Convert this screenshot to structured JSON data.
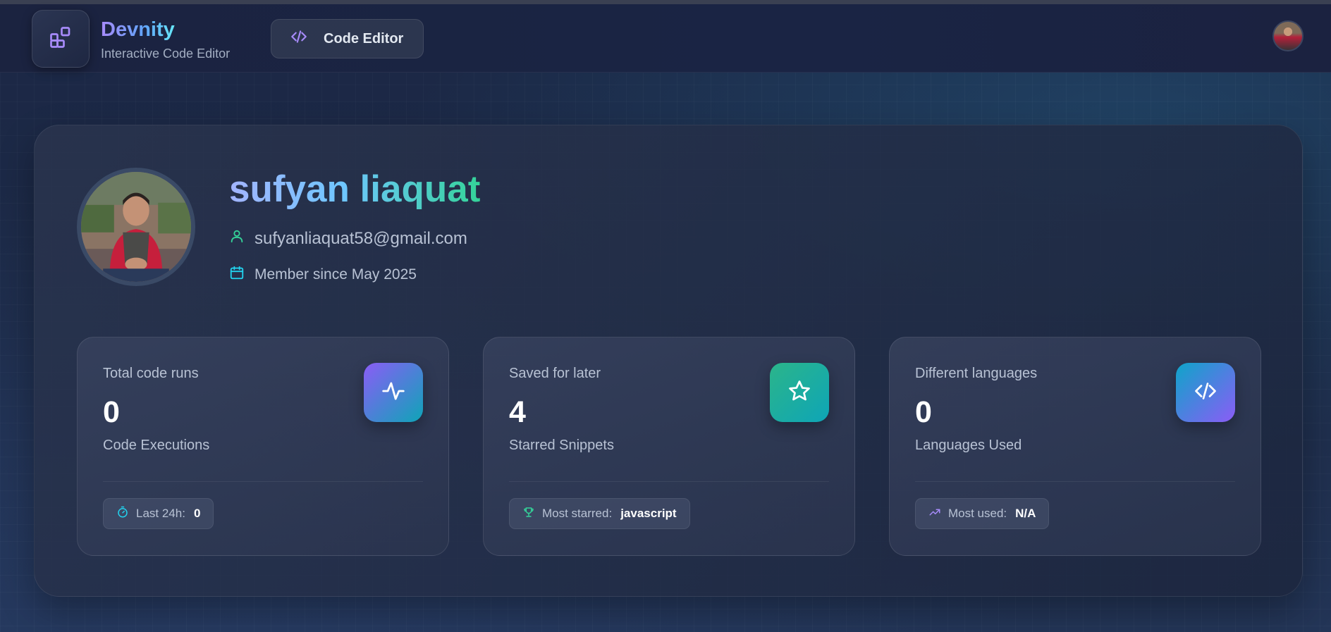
{
  "brand": {
    "title": "Devnity",
    "subtitle": "Interactive Code Editor"
  },
  "nav": {
    "code_editor_label": "Code Editor",
    "code_icon": "code-icon"
  },
  "profile": {
    "name": "sufyan liaquat",
    "email": "sufyanliaquat58@gmail.com",
    "member_since": "Member since May 2025"
  },
  "stats": [
    {
      "label": "Total code runs",
      "value": "0",
      "description": "Code Executions",
      "icon": "activity-icon",
      "pill_icon": "timer-icon",
      "pill_label": "Last 24h:",
      "pill_value": "0",
      "gradient": [
        "#8b5cf6",
        "#0ea5b7"
      ]
    },
    {
      "label": "Saved for later",
      "value": "4",
      "description": "Starred Snippets",
      "icon": "star-icon",
      "pill_icon": "trophy-icon",
      "pill_label": "Most starred:",
      "pill_value": "javascript",
      "gradient": [
        "#2bb58a",
        "#0ea5b7"
      ]
    },
    {
      "label": "Different languages",
      "value": "0",
      "description": "Languages Used",
      "icon": "code-icon",
      "pill_icon": "trending-up-icon",
      "pill_label": "Most used:",
      "pill_value": "N/A",
      "gradient": [
        "#0ea5c9",
        "#8b5cf6"
      ]
    }
  ],
  "colors": {
    "accent_purple": "#a78bfa",
    "accent_cyan": "#22d3ee",
    "accent_green": "#34d399"
  }
}
